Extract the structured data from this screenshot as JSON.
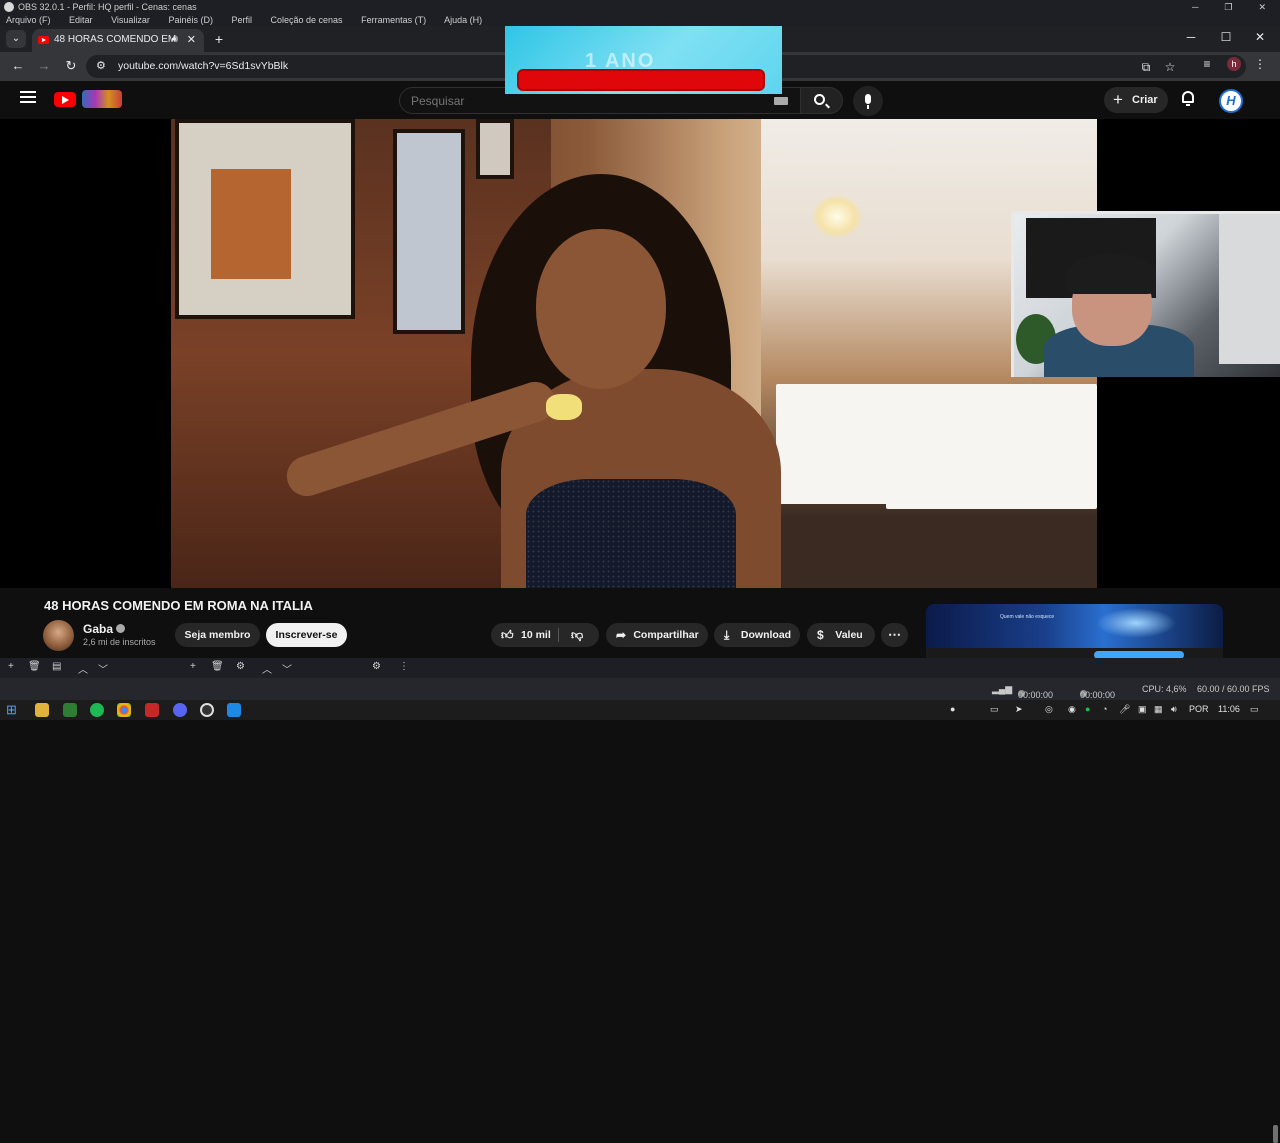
{
  "obs": {
    "title": "OBS 32.0.1 - Perfil: HQ perfil - Cenas: cenas",
    "menu": [
      "Arquivo (F)",
      "Editar",
      "Visualizar",
      "Painéis (D)",
      "Perfil",
      "Coleção de cenas",
      "Ferramentas (T)",
      "Ajuda (H)"
    ],
    "status": {
      "rec_time": "00:00:00",
      "stream_time": "00:00:00",
      "cpu": "CPU: 4,6%",
      "fps": "60.00 / 60.00 FPS"
    }
  },
  "browser": {
    "tab_title": "48 HORAS COMENDO EM",
    "url": "youtube.com/watch?v=6Sd1svYbBlk",
    "profile_initial": "h"
  },
  "overlay": {
    "banner_text": "1 ANO"
  },
  "youtube": {
    "search_placeholder": "Pesquisar",
    "create_label": "Criar",
    "avatar_letter": "H",
    "video": {
      "title": "48 HORAS COMENDO EM ROMA NA ITALIA",
      "channel": "Gaba",
      "subscribers": "2,6 mi de inscritos",
      "join_label": "Seja membro",
      "subscribe_label": "Inscrever-se",
      "likes": "10 mil",
      "share_label": "Compartilhar",
      "download_label": "Download",
      "thanks_label": "Valeu"
    },
    "side_ad_text": "Quem vale não esquece"
  },
  "taskbar": {
    "language": "POR",
    "time": "11:06"
  },
  "colors": {
    "youtube_red": "#ff0000",
    "banner_cyan": "#2fc5e6",
    "banner_bar_red": "#e0070b",
    "subscribe_bg": "#f1f1f1"
  },
  "icons": [
    "menu-icon",
    "youtube-logo",
    "search-icon",
    "mic-icon",
    "plus-icon",
    "bell-icon",
    "thumbs-up-icon",
    "thumbs-down-icon",
    "share-icon",
    "download-icon",
    "thanks-icon",
    "more-icon"
  ]
}
